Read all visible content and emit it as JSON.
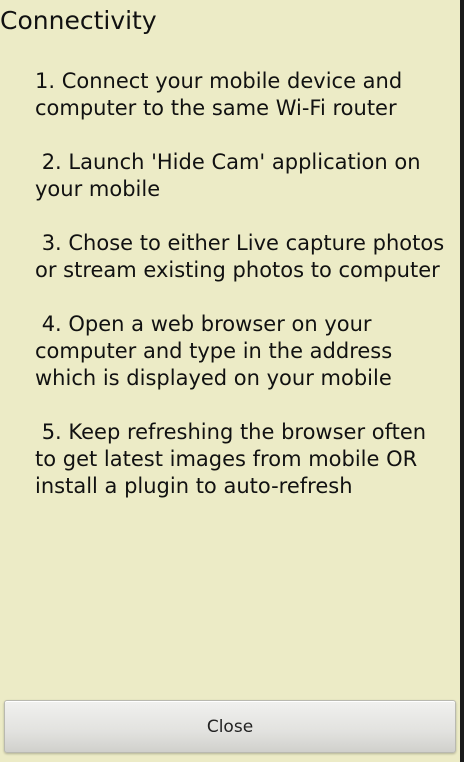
{
  "dialog": {
    "title": "Connectivity",
    "steps": [
      "1. Connect your mobile device and computer to the same Wi-Fi router",
      " 2. Launch 'Hide Cam' application on your mobile",
      " 3. Chose to either Live capture photos or stream existing photos to computer",
      " 4. Open a web browser on your computer and type in the address which is displayed on your mobile",
      " 5. Keep refreshing the browser often to get latest images from mobile OR install a plugin to auto-refresh"
    ],
    "close_label": "Close"
  },
  "colors": {
    "background": "#ecebc6",
    "text": "#111111",
    "button": "#e2e2df"
  }
}
